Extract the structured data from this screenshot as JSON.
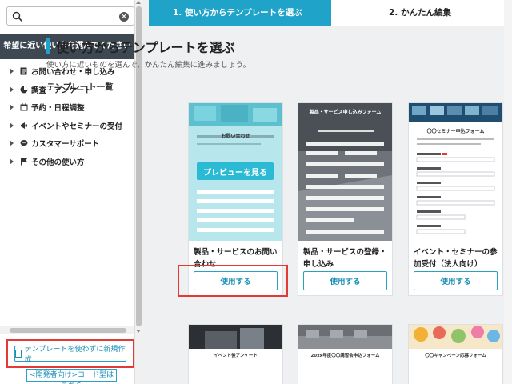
{
  "sidebar": {
    "search": {
      "value": "",
      "placeholder": ""
    },
    "filter_header": "希望に近い使い方を選んでください",
    "menu": [
      {
        "label": "お問い合わせ・申し込み",
        "icon": "document-icon"
      },
      {
        "label": "調査・アンケート",
        "icon": "pie-chart-icon"
      },
      {
        "label": "予約・日程調整",
        "icon": "calendar-icon"
      },
      {
        "label": "イベントやセミナーの受付",
        "icon": "megaphone-icon"
      },
      {
        "label": "カスタマーサポート",
        "icon": "chat-icon"
      },
      {
        "label": "その他の使い方",
        "icon": "flag-icon"
      }
    ],
    "new_button": "テンプレートを使わずに新規作成",
    "dev_link": "<開発者向け>コード型はこちら"
  },
  "steps": {
    "step1": "1. 使い方からテンプレートを選ぶ",
    "step2": "2. かんたん編集"
  },
  "main": {
    "title": "使い方からテンプレートを選ぶ",
    "subtitle": "使い方に近いものを選んで、かんたん編集に進みましょう。",
    "section": "テンプレート一覧",
    "preview_label": "プレビューを見る",
    "cards": [
      {
        "name": "製品・サービスのお問い合わせ",
        "use": "使用する",
        "thumb_title": "お問い合わせ"
      },
      {
        "name": "製品・サービスの登録・申し込み",
        "use": "使用する",
        "thumb_title": "製品・サービス申し込みフォーム"
      },
      {
        "name": "イベント・セミナーの参加受付（法人向け）",
        "use": "使用する",
        "thumb_title": "〇〇セミナー申込フォーム"
      }
    ],
    "lower_cards": [
      {
        "thumb_title": "イベント後アンケート"
      },
      {
        "thumb_title": "20xx年度〇〇講習会申込フォーム"
      },
      {
        "thumb_title": "〇〇キャンペーン応募フォーム"
      }
    ]
  },
  "colors": {
    "accent": "#1fa3c8",
    "header_dark": "#3d4852",
    "highlight": "#e53935"
  }
}
